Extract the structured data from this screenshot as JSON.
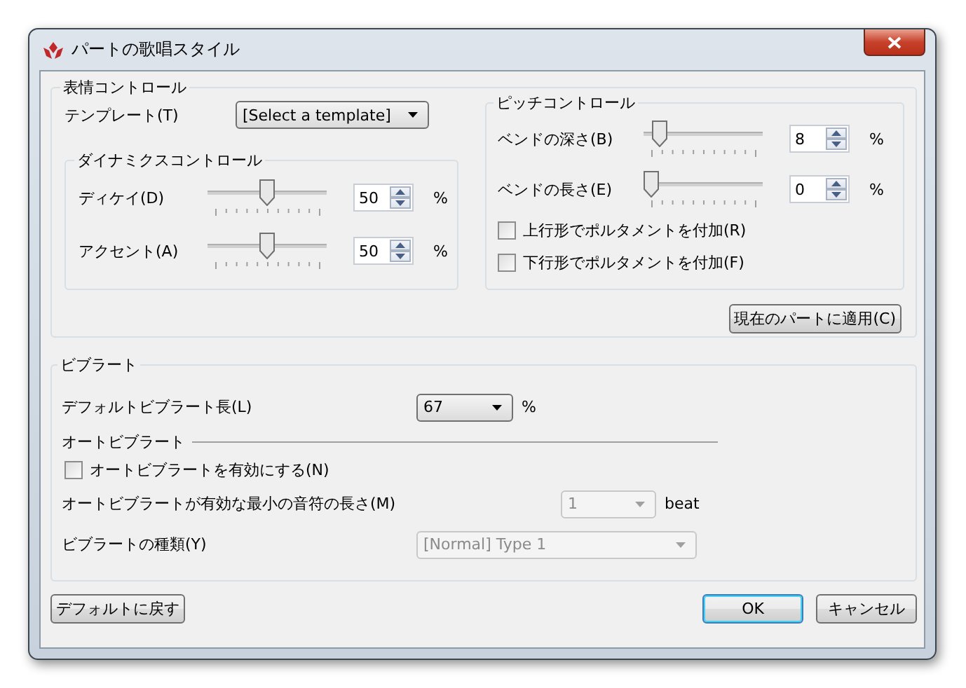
{
  "window": {
    "title": "パートの歌唱スタイル"
  },
  "expression": {
    "title": "表情コントロール",
    "template": {
      "label": "テンプレート(T)",
      "value": "[Select a template]"
    },
    "dynamics": {
      "title": "ダイナミクスコントロール",
      "rows": [
        {
          "label": "ディケイ(D)",
          "level": 0.5,
          "value": "50",
          "unit": "%"
        },
        {
          "label": "アクセント(A)",
          "level": 0.5,
          "value": "50",
          "unit": "%"
        }
      ]
    },
    "pitch": {
      "title": "ピッチコントロール",
      "rows": [
        {
          "label": "ベンドの深さ(B)",
          "level": 0.08,
          "value": "8",
          "unit": "%"
        },
        {
          "label": "ベンドの長さ(E)",
          "level": 0,
          "value": "0",
          "unit": "%"
        }
      ],
      "checkboxes": [
        {
          "label": "上行形でポルタメントを付加(R)",
          "checked": false
        },
        {
          "label": "下行形でポルタメントを付加(F)",
          "checked": false
        }
      ]
    },
    "apply_button": "現在のパートに適用(C)"
  },
  "vibrato": {
    "title": "ビブラート",
    "default_length": {
      "label": "デフォルトビブラート長(L)",
      "value": "67",
      "unit": "%",
      "disabled": false
    },
    "auto_title": "オートビブラート",
    "auto_enable": {
      "label": "オートビブラートを有効にする(N)",
      "checked": false
    },
    "min_length": {
      "label": "オートビブラートが有効な最小の音符の長さ(M)",
      "value": "1",
      "unit": "beat",
      "disabled": true
    },
    "type": {
      "label": "ビブラートの種類(Y)",
      "value": "[Normal] Type 1",
      "disabled": true
    }
  },
  "buttons": [
    {
      "label": "デフォルトに戻す",
      "default": false
    },
    {
      "label": "OK",
      "default": true
    },
    {
      "label": "キャンセル",
      "default": false
    }
  ]
}
